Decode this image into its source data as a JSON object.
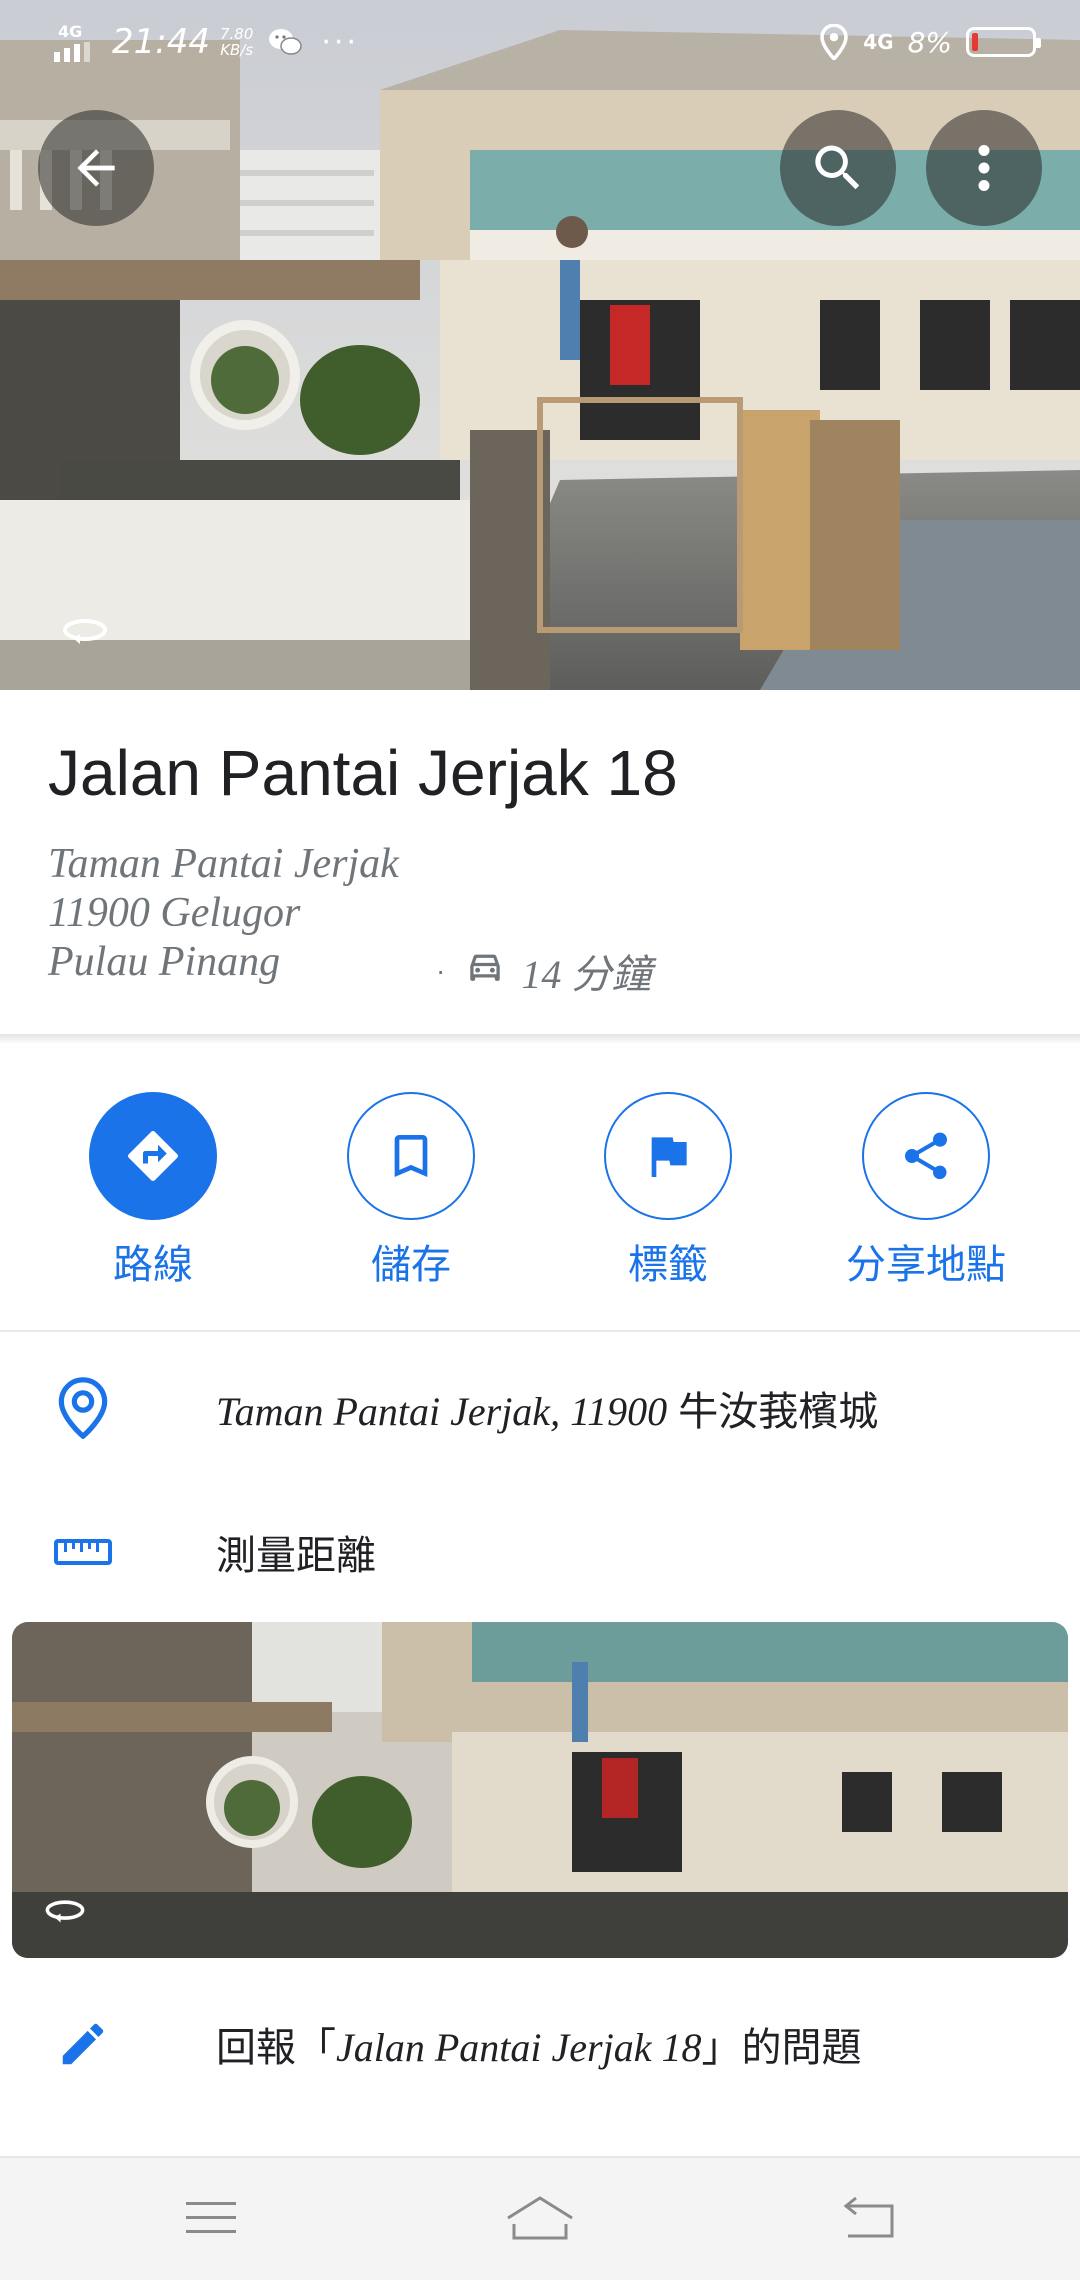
{
  "status_bar": {
    "network": "4G",
    "time": "21:44",
    "speed_value": "7.80",
    "speed_unit": "KB/s",
    "more": "···",
    "network_right": "4G",
    "battery": "8%"
  },
  "place": {
    "title": "Jalan Pantai Jerjak 18",
    "address_lines": [
      "Taman Pantai Jerjak",
      "11900 Gelugor",
      "Pulau Pinang"
    ],
    "drive_separator": "·",
    "drive_time": "14 分鐘"
  },
  "actions": [
    {
      "label": "路線"
    },
    {
      "label": "儲存"
    },
    {
      "label": "標籤"
    },
    {
      "label": "分享地點"
    }
  ],
  "list": {
    "address_italic": "Taman Pantai Jerjak, 11900",
    "address_suffix": " 牛汝莪檳城",
    "measure": "測量距離",
    "report_prefix": "回報「",
    "report_name": "Jalan Pantai Jerjak 18",
    "report_suffix": "」的問題"
  },
  "colors": {
    "accent": "#1a73e8",
    "text_primary": "#202124",
    "text_secondary": "#70757a",
    "battery_low": "#e53935"
  },
  "icons": {
    "back": "arrow-left-icon",
    "search": "search-icon",
    "more": "more-vert-icon",
    "street_view": "street-view-360-icon",
    "directions": "directions-icon",
    "save": "bookmark-icon",
    "label": "flag-icon",
    "share": "share-icon",
    "location": "location-pin-icon",
    "measure": "ruler-icon",
    "edit": "pencil-icon",
    "car": "car-icon",
    "nav_menu": "menu-icon",
    "nav_home": "home-icon",
    "nav_back": "back-icon"
  }
}
